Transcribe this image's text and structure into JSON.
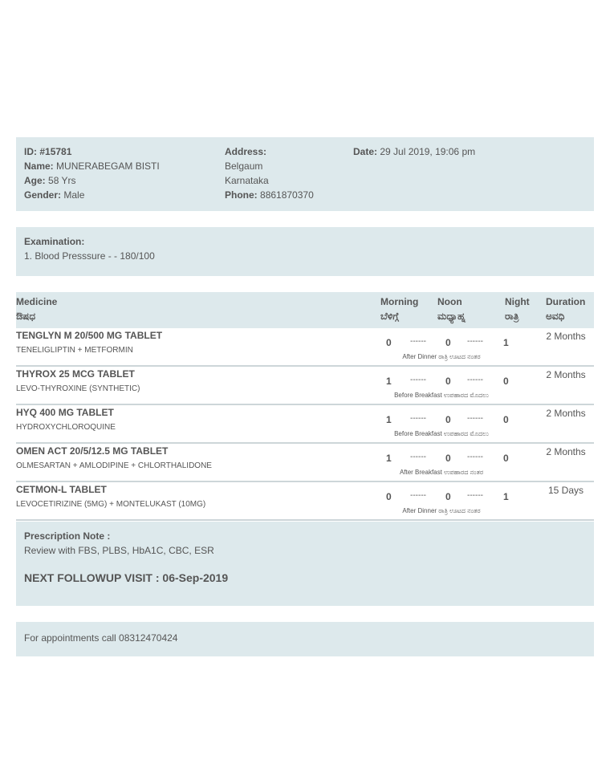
{
  "patient": {
    "id_label": "ID:",
    "id_value": "#15781",
    "name_label": "Name:",
    "name_value": "MUNERABEGAM BISTI",
    "age_label": "Age:",
    "age_value": "58 Yrs",
    "gender_label": "Gender:",
    "gender_value": "Male",
    "address_label": "Address:",
    "address_line1": "Belgaum",
    "address_line2": "Karnataka",
    "phone_label": "Phone:",
    "phone_value": "8861870370",
    "date_label": "Date:",
    "date_value": "29 Jul 2019, 19:06 pm"
  },
  "examination": {
    "label": "Examination:",
    "items": [
      "1. Blood Presssure - - 180/100"
    ]
  },
  "medicine_table": {
    "headers": {
      "medicine": "Medicine",
      "medicine_kn": "ಔಷಧ",
      "morning": "Morning",
      "morning_kn": "ಬೆಳಿಗ್ಗೆ",
      "noon": "Noon",
      "noon_kn": "ಮಧ್ಯಾಹ್ನ",
      "night": "Night",
      "night_kn": "ರಾತ್ರಿ",
      "duration": "Duration",
      "duration_kn": "ಅವಧಿ"
    },
    "separator": "------",
    "rows": [
      {
        "name": "TENGLYN M 20/500 MG TABLET",
        "generic": "TENELIGLIPTIN + METFORMIN",
        "morning": "0",
        "noon": "0",
        "night": "1",
        "instruction": "After Dinner ರಾತ್ರಿ ಊಟದ ನಂತರ",
        "duration": "2 Months"
      },
      {
        "name": "THYROX 25 MCG TABLET",
        "generic": "LEVO-THYROXINE (SYNTHETIC)",
        "morning": "1",
        "noon": "0",
        "night": "0",
        "instruction": "Before Breakfast ಉಪಹಾರದ ಮೊದಲು",
        "duration": "2 Months"
      },
      {
        "name": "HYQ 400 MG TABLET",
        "generic": "HYDROXYCHLOROQUINE",
        "morning": "1",
        "noon": "0",
        "night": "0",
        "instruction": "Before Breakfast ಉಪಹಾರದ ಮೊದಲು",
        "duration": "2 Months"
      },
      {
        "name": "OMEN ACT 20/5/12.5 MG TABLET",
        "generic": "OLMESARTAN + AMLODIPINE + CHLORTHALIDONE",
        "morning": "1",
        "noon": "0",
        "night": "0",
        "instruction": "After Breakfast ಉಪಹಾರದ ನಂತರ",
        "duration": "2 Months"
      },
      {
        "name": "CETMON-L TABLET",
        "generic": "LEVOCETIRIZINE (5MG) + MONTELUKAST (10MG)",
        "morning": "0",
        "noon": "0",
        "night": "1",
        "instruction": "After Dinner ರಾತ್ರಿ ಊಟದ ನಂತರ",
        "duration": "15 Days"
      }
    ]
  },
  "prescription_note": {
    "label": "Prescription Note :",
    "text": "Review with FBS, PLBS, HbA1C, CBC, ESR",
    "followup": "NEXT FOLLOWUP VISIT : 06-Sep-2019"
  },
  "footer": {
    "appointment_text": "For appointments call 08312470424"
  },
  "colors": {
    "band": "#dde9ec",
    "text": "#555555",
    "row_divider": "#cdd6d9"
  }
}
